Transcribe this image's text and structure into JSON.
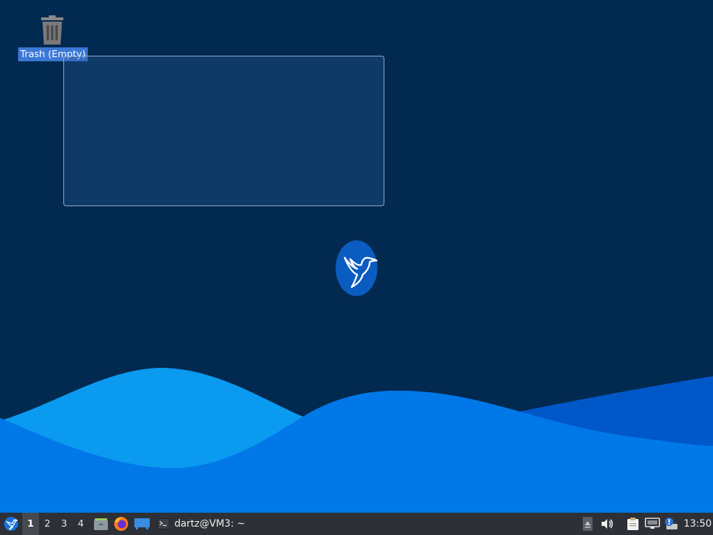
{
  "desktop": {
    "background_color": "#02294f",
    "wave_colors": [
      "#0a9af0",
      "#0078e8",
      "#0058c8"
    ],
    "icons": [
      {
        "label": "Trash (Empty)",
        "icon": "trash-icon",
        "selected": true
      }
    ],
    "center_logo": "lubuntu-bird-logo"
  },
  "taskbar": {
    "menu_icon": "lubuntu-menu-icon",
    "workspaces": [
      {
        "label": "1",
        "active": true
      },
      {
        "label": "2",
        "active": false
      },
      {
        "label": "3",
        "active": false
      },
      {
        "label": "4",
        "active": false
      }
    ],
    "quicklaunch": [
      "file-manager-icon",
      "firefox-icon",
      "show-desktop-icon"
    ],
    "window_button": {
      "icon": "terminal-icon",
      "label": "dartz@VM3: ~"
    },
    "tray": [
      "tray-expand-icon",
      "volume-icon",
      "clipboard-icon",
      "network-icon",
      "update-notifier-icon"
    ],
    "clock": "13:50"
  }
}
